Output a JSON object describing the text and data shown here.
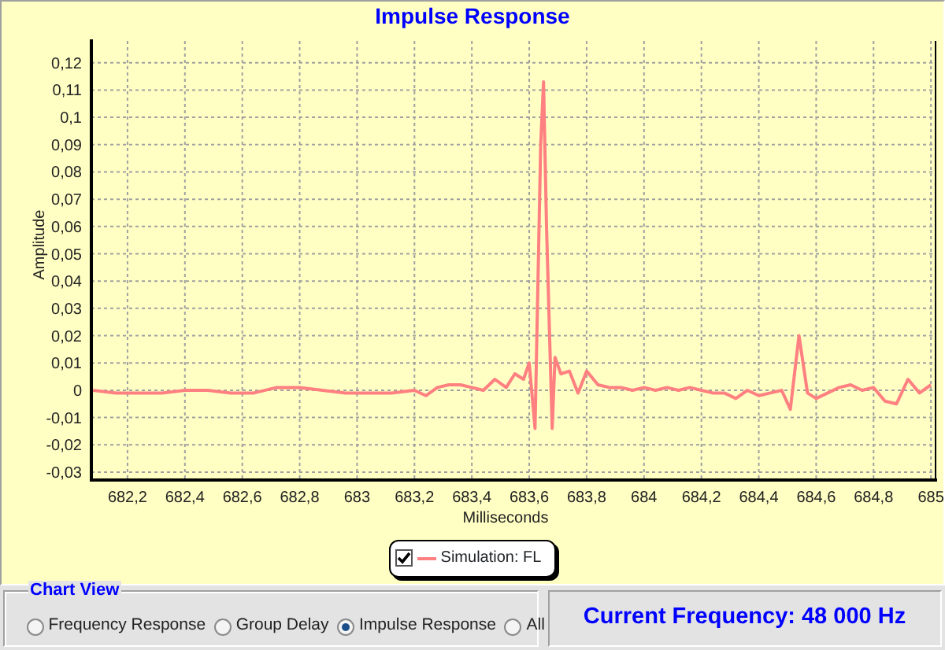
{
  "chart": {
    "title": "Impulse Response",
    "chart_data": {
      "type": "line",
      "grid": true,
      "xlabel": "Milliseconds",
      "ylabel": "Amplitude",
      "xlim": [
        682.074,
        685.016
      ],
      "ylim": [
        -0.0329,
        0.128
      ],
      "xticks": [
        {
          "value": 682.2,
          "label": "682,2"
        },
        {
          "value": 682.4,
          "label": "682,4"
        },
        {
          "value": 682.6,
          "label": "682,6"
        },
        {
          "value": 682.8,
          "label": "682,8"
        },
        {
          "value": 683,
          "label": "683"
        },
        {
          "value": 683.2,
          "label": "683,2"
        },
        {
          "value": 683.4,
          "label": "683,4"
        },
        {
          "value": 683.6,
          "label": "683,6"
        },
        {
          "value": 683.8,
          "label": "683,8"
        },
        {
          "value": 684,
          "label": "684"
        },
        {
          "value": 684.2,
          "label": "684,2"
        },
        {
          "value": 684.4,
          "label": "684,4"
        },
        {
          "value": 684.6,
          "label": "684,6"
        },
        {
          "value": 684.8,
          "label": "684,8"
        },
        {
          "value": 685,
          "label": "685"
        }
      ],
      "yticks": [
        {
          "value": 0.12,
          "label": "0,12"
        },
        {
          "value": 0.11,
          "label": "0,11"
        },
        {
          "value": 0.1,
          "label": "0,1"
        },
        {
          "value": 0.09,
          "label": "0,09"
        },
        {
          "value": 0.08,
          "label": "0,08"
        },
        {
          "value": 0.07,
          "label": "0,07"
        },
        {
          "value": 0.06,
          "label": "0,06"
        },
        {
          "value": 0.05,
          "label": "0,05"
        },
        {
          "value": 0.04,
          "label": "0,04"
        },
        {
          "value": 0.03,
          "label": "0,03"
        },
        {
          "value": 0.02,
          "label": "0,02"
        },
        {
          "value": 0.01,
          "label": "0,01"
        },
        {
          "value": 0,
          "label": "0"
        },
        {
          "value": -0.01,
          "label": "-0,01"
        },
        {
          "value": -0.02,
          "label": "-0,02"
        },
        {
          "value": -0.03,
          "label": "-0,03"
        }
      ],
      "x": [
        682.08,
        682.16,
        682.24,
        682.32,
        682.4,
        682.48,
        682.56,
        682.64,
        682.72,
        682.8,
        682.88,
        682.96,
        683.04,
        683.12,
        683.2,
        683.24,
        683.28,
        683.32,
        683.36,
        683.4,
        683.44,
        683.48,
        683.52,
        683.55,
        683.58,
        683.6,
        683.62,
        683.64,
        683.65,
        683.66,
        683.68,
        683.69,
        683.71,
        683.74,
        683.77,
        683.8,
        683.84,
        683.88,
        683.92,
        683.96,
        684.0,
        684.04,
        684.08,
        684.12,
        684.16,
        684.2,
        684.24,
        684.28,
        684.32,
        684.36,
        684.4,
        684.44,
        684.48,
        684.51,
        684.54,
        684.57,
        684.6,
        684.64,
        684.68,
        684.72,
        684.76,
        684.8,
        684.84,
        684.88,
        684.92,
        684.96,
        685.0
      ],
      "series": [
        {
          "name": "Simulation: FL",
          "color": "#ff8080",
          "values": [
            0,
            -0.001,
            -0.001,
            -0.001,
            0,
            0,
            -0.001,
            -0.001,
            0.001,
            0.001,
            0,
            -0.001,
            -0.001,
            -0.001,
            0,
            -0.002,
            0.001,
            0.002,
            0.002,
            0.001,
            0,
            0.004,
            0.001,
            0.006,
            0.004,
            0.01,
            -0.014,
            0.09,
            0.113,
            0.06,
            -0.014,
            0.012,
            0.006,
            0.007,
            -0.001,
            0.007,
            0.002,
            0.001,
            0.001,
            0,
            0.001,
            0,
            0.001,
            0,
            0.001,
            0,
            -0.001,
            -0.001,
            -0.003,
            0,
            -0.002,
            -0.001,
            0,
            -0.007,
            0.02,
            -0.001,
            -0.003,
            -0.001,
            0.001,
            0.002,
            0,
            0.001,
            -0.004,
            -0.005,
            0.004,
            -0.001,
            0.002
          ]
        }
      ]
    },
    "legend": [
      {
        "checked": true
      }
    ]
  },
  "chart_view": {
    "title": "Chart View",
    "options": [
      {
        "label": "Frequency Response",
        "selected": false
      },
      {
        "label": "Group Delay",
        "selected": false
      },
      {
        "label": "Impulse Response",
        "selected": true
      },
      {
        "label": "All",
        "selected": false
      }
    ]
  },
  "status": "Current Frequency: 48 000 Hz"
}
